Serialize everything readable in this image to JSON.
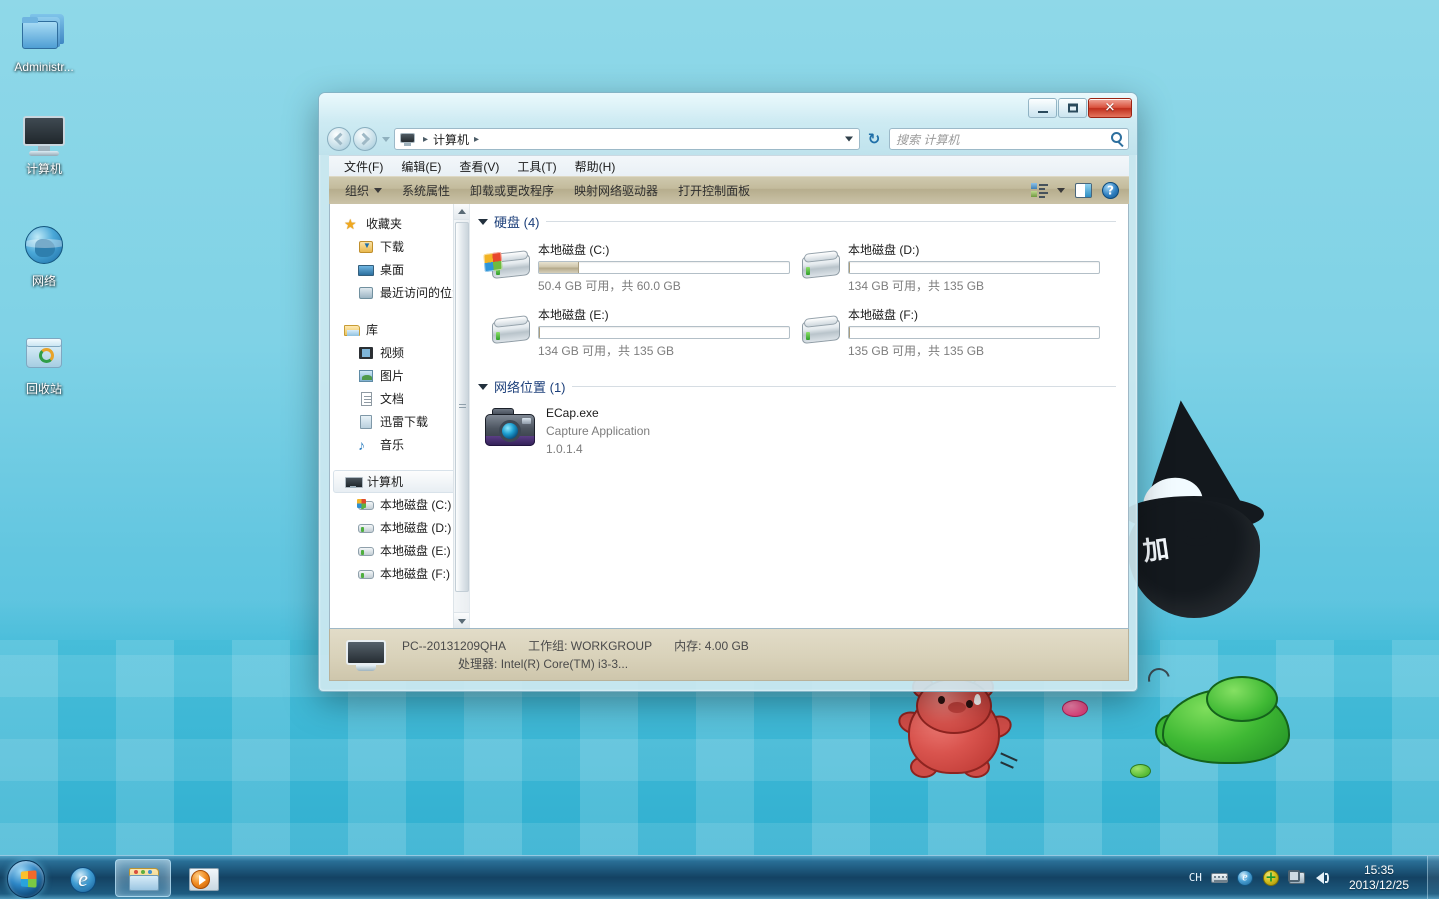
{
  "desktop": {
    "icons": [
      {
        "label": "Administr...",
        "icon": "folder-icon"
      },
      {
        "label": "计算机",
        "icon": "computer-icon"
      },
      {
        "label": "网络",
        "icon": "network-globe-icon"
      },
      {
        "label": "回收站",
        "icon": "recycle-bin-icon"
      }
    ]
  },
  "window": {
    "titlebar": {
      "minimize_label": "",
      "maximize_label": "",
      "close_label": "✕"
    },
    "nav": {
      "back_tooltip": "后退",
      "forward_tooltip": "前进",
      "breadcrumb_root": "计算机",
      "separator": "▸",
      "refresh_glyph": "↻"
    },
    "search": {
      "placeholder": "搜索 计算机",
      "value": ""
    },
    "menu": [
      {
        "label": "文件(F)"
      },
      {
        "label": "编辑(E)"
      },
      {
        "label": "查看(V)"
      },
      {
        "label": "工具(T)"
      },
      {
        "label": "帮助(H)"
      }
    ],
    "toolbar": {
      "organize_label": "组织",
      "items": [
        {
          "label": "系统属性"
        },
        {
          "label": "卸载或更改程序"
        },
        {
          "label": "映射网络驱动器"
        },
        {
          "label": "打开控制面板"
        }
      ],
      "view_icon": "view-mode-icon",
      "pane_icon": "preview-pane-icon",
      "help_icon": "help-icon"
    },
    "sidebar": {
      "groups": [
        {
          "header": {
            "label": "收藏夹",
            "icon": "star-icon"
          },
          "items": [
            {
              "label": "下载",
              "icon": "downloads-icon"
            },
            {
              "label": "桌面",
              "icon": "desktop-icon"
            },
            {
              "label": "最近访问的位置",
              "icon": "recent-places-icon"
            }
          ]
        },
        {
          "header": {
            "label": "库",
            "icon": "library-icon"
          },
          "items": [
            {
              "label": "视频",
              "icon": "video-icon"
            },
            {
              "label": "图片",
              "icon": "picture-icon"
            },
            {
              "label": "文档",
              "icon": "document-icon"
            },
            {
              "label": "迅雷下载",
              "icon": "thunder-download-icon"
            },
            {
              "label": "音乐",
              "icon": "music-icon"
            }
          ]
        },
        {
          "header": {
            "label": "计算机",
            "icon": "computer-icon",
            "selected": true
          },
          "items": [
            {
              "label": "本地磁盘 (C:)",
              "icon": "windows-drive-icon"
            },
            {
              "label": "本地磁盘 (D:)",
              "icon": "drive-icon"
            },
            {
              "label": "本地磁盘 (E:)",
              "icon": "drive-icon"
            },
            {
              "label": "本地磁盘 (F:)",
              "icon": "drive-icon"
            }
          ]
        }
      ]
    },
    "content": {
      "hard_disks": {
        "header": "硬盘 (4)",
        "drives": [
          {
            "name": "本地磁盘 (C:)",
            "free": "50.4 GB 可用，共 60.0 GB",
            "used_percent": 16,
            "system": true
          },
          {
            "name": "本地磁盘 (D:)",
            "free": "134 GB 可用，共 135 GB",
            "used_percent": 0,
            "system": false
          },
          {
            "name": "本地磁盘 (E:)",
            "free": "134 GB 可用，共 135 GB",
            "used_percent": 0,
            "system": false
          },
          {
            "name": "本地磁盘 (F:)",
            "free": "135 GB 可用，共 135 GB",
            "used_percent": 0,
            "system": false
          }
        ]
      },
      "network_locations": {
        "header": "网络位置 (1)",
        "items": [
          {
            "name": "ECap.exe",
            "description": "Capture Application",
            "version": "1.0.1.4",
            "icon": "camera-icon"
          }
        ]
      }
    },
    "statusbar": {
      "computer_name": "PC--20131209QHA",
      "workgroup_label": "工作组:",
      "workgroup_value": "WORKGROUP",
      "memory_label": "内存:",
      "memory_value": "4.00 GB",
      "processor_label": "处理器:",
      "processor_value": "Intel(R) Core(TM) i3-3..."
    }
  },
  "taskbar": {
    "start_label": "开始",
    "buttons": [
      {
        "name": "internet-explorer",
        "icon": "ie-icon",
        "active": false
      },
      {
        "name": "windows-explorer",
        "icon": "explorer-icon",
        "active": true
      },
      {
        "name": "windows-media-player",
        "icon": "media-player-icon",
        "active": false
      }
    ],
    "tray": {
      "ime_label": "CH",
      "icons": [
        {
          "name": "keyboard-icon"
        },
        {
          "name": "ie-tray-icon"
        },
        {
          "name": "security-shield-icon"
        },
        {
          "name": "network-icon"
        },
        {
          "name": "volume-icon"
        }
      ],
      "time": "15:35",
      "date": "2013/12/25"
    }
  },
  "colors": {
    "accent": "#1c3f7a",
    "toolbar_bg": "#c3bb9c",
    "statusbar_bg": "#d9d2ba",
    "drive_bar_fill": "#cfc6ac",
    "desktop_bg": "#7fd2e6",
    "close_button": "#d9513c"
  }
}
